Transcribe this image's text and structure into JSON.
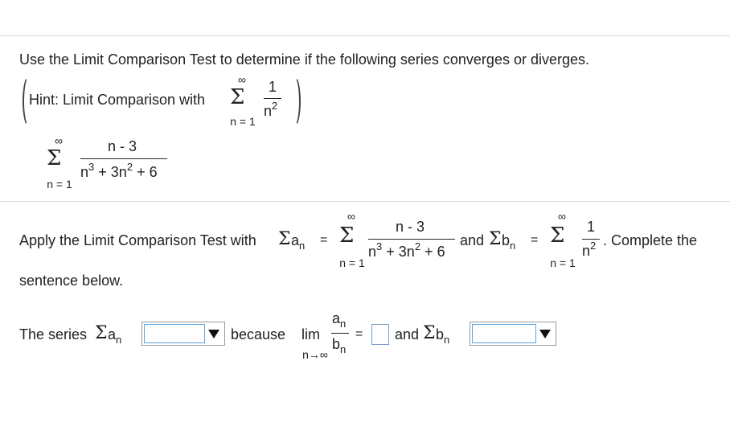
{
  "question": "Use the Limit Comparison Test to determine if the following series converges or diverges.",
  "hint": {
    "label": "Hint: Limit Comparison with",
    "sum_upper": "∞",
    "sum_lower": "n = 1",
    "numerator": "1",
    "denominator": "n"
  },
  "series": {
    "sum_upper": "∞",
    "sum_lower": "n = 1",
    "numerator": "n - 3",
    "den_n3": "n",
    "den_3n2": "+ 3n",
    "den_6": "+ 6"
  },
  "apply": {
    "prefix": "Apply the Limit Comparison Test with",
    "a": "a",
    "eq": "=",
    "and": "and",
    "b": "b",
    "suffix": ". Complete the",
    "line2": "sentence below."
  },
  "sentence": {
    "prefix": "The series",
    "because": "because",
    "lim": "lim",
    "lim_sub": "n→∞",
    "frac_num": "a",
    "frac_den": "b",
    "eq": "=",
    "and": "and"
  },
  "exp": {
    "two": "2",
    "three": "3"
  },
  "sub": {
    "n": "n"
  },
  "dropdowns": {
    "series_a_value": "",
    "series_b_value": ""
  },
  "limit_input": {
    "value": ""
  }
}
